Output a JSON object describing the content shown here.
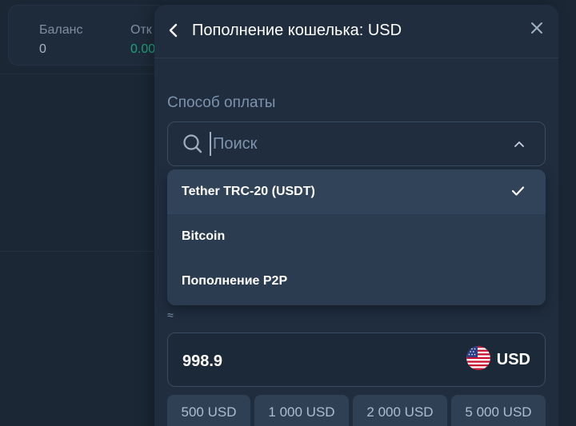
{
  "background": {
    "balance_label": "Баланс",
    "balance_value": "0",
    "second_label": "Отк",
    "second_value": "0.00"
  },
  "modal": {
    "title": "Пополнение кошелька: USD",
    "payment_method_label": "Способ оплаты",
    "search": {
      "placeholder": "Поиск",
      "value": ""
    },
    "options": [
      {
        "label": "Tether TRC-20 (USDT)",
        "selected": true
      },
      {
        "label": "Bitcoin",
        "selected": false
      },
      {
        "label": "Пополнение P2P",
        "selected": false
      }
    ],
    "approx_symbol": "≈",
    "amount": {
      "value": "998.9",
      "currency": "USD",
      "flag": "us-flag-icon"
    },
    "presets": [
      "500 USD",
      "1 000 USD",
      "2 000 USD",
      "5 000 USD"
    ]
  },
  "colors": {
    "background": "#1b2735",
    "modal": "#1f2d3e",
    "dropdown": "#2b3b50",
    "muted_text": "#7e93ad",
    "green": "#1fa37a"
  }
}
